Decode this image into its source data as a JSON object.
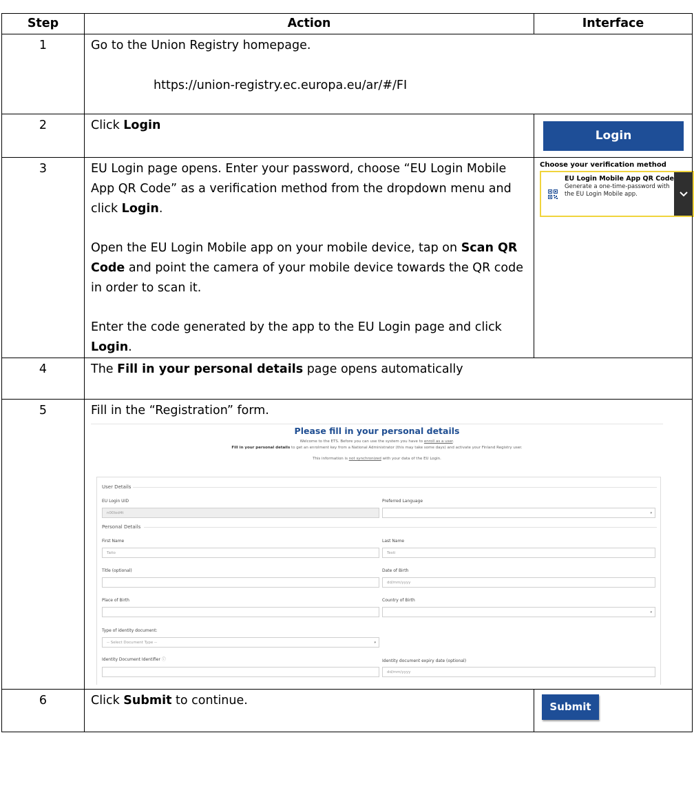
{
  "table": {
    "headers": [
      "Step",
      "Action",
      "Interface"
    ],
    "rows": [
      {
        "step": "1",
        "text": "Go to the Union Registry homepage.",
        "url": "https://union-registry.ec.europa.eu/ar/#/FI"
      },
      {
        "step": "2",
        "pre": "Click ",
        "bold": "Login",
        "post": "",
        "button_label": "Login"
      },
      {
        "step": "3",
        "p1_pre": "EU Login page opens. Enter your password, choose “EU Login Mobile App QR Code” as a verification method from the dropdown menu and click ",
        "p1_bold": "Login",
        "p1_post": ".",
        "p2_pre": "Open the EU Login Mobile app on your mobile device, tap on ",
        "p2_bold": "Scan QR Code",
        "p2_post": " and point the camera of your mobile device towards the QR code in order to scan it.",
        "p3_pre": "Enter the code generated by the app to the EU Login page and click ",
        "p3_bold": "Login",
        "p3_post": ".",
        "verification": {
          "title": "Choose your verification method",
          "option_title": "EU Login Mobile App QR Code",
          "option_desc": "Generate a one-time-password with the EU Login Mobile app.",
          "icon": "qr-code-icon",
          "chevron": "chevron-down-icon"
        }
      },
      {
        "step": "4",
        "pre": "The ",
        "bold": "Fill in your personal details",
        "post": " page opens automatically"
      },
      {
        "step": "5",
        "text": "Fill in the “Registration” form."
      },
      {
        "step": "6",
        "pre": "Click ",
        "bold": "Submit",
        "post": " to continue.",
        "button_label": "Submit"
      }
    ]
  },
  "form": {
    "title": "Please fill in your personal details",
    "intro1_pre": "Welcome to the ETS. Before you can use the system you have to ",
    "intro1_link": "enroll as a user",
    "intro1_post": ".",
    "intro2_bold": "Fill in your personal details",
    "intro2_rest": " to get an enrolment key from a National Administrator (this may take some days) and activate your Finland Registry user.",
    "intro3_pre": "This information is ",
    "intro3_link": "not synchronized",
    "intro3_post": " with your data of the EU Login.",
    "section_user": "User Details",
    "section_personal": "Personal Details",
    "label_uid": "EU Login UID",
    "value_uid": "n00lod4t",
    "label_language": "Preferred Language",
    "label_first": "First Name",
    "value_first": "Taito",
    "label_last": "Last Name",
    "value_last": "Testi",
    "label_title": "Title (optional)",
    "label_dob": "Date of Birth",
    "placeholder_dob": "dd/mm/yyyy",
    "label_pob": "Place of Birth",
    "label_cob": "Country of Birth",
    "label_idtype": "Type of identity document:",
    "placeholder_idtype": "-- Select Document Type --",
    "label_idnum": "Identity Document Identifier",
    "label_idexp": "Identity document expiry date (optional)",
    "placeholder_idexp": "dd/mm/yyyy"
  },
  "colors": {
    "brand_blue": "#1e4e97",
    "form_title": "#1f4e92",
    "highlight": "#f0d43c"
  }
}
